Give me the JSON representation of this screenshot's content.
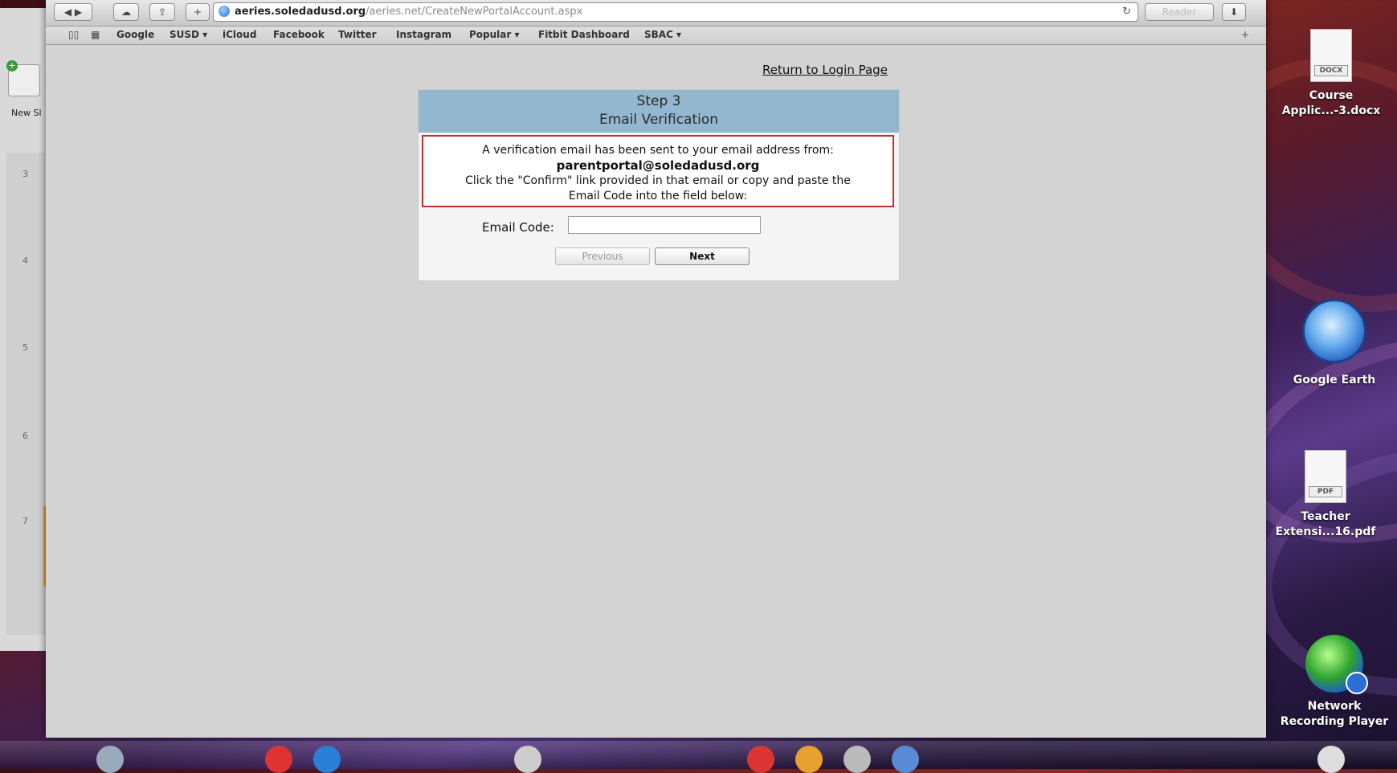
{
  "browser": {
    "url_host": "aeries.soledadusd.org",
    "url_path": "/aeries.net/CreateNewPortalAccount.aspx",
    "reader_label": "Reader",
    "bookmarks": [
      "Google",
      "SUSD ▾",
      "iCloud",
      "Facebook",
      "Twitter",
      "Instagram",
      "Popular ▾",
      "Fitbit Dashboard",
      "SBAC ▾"
    ]
  },
  "background_app": {
    "new_slide_label": "New Sl",
    "slide_numbers": [
      "3",
      "4",
      "5",
      "6",
      "7"
    ]
  },
  "page": {
    "return_link": "Return to Login Page",
    "step_title": "Step 3",
    "step_subtitle": "Email Verification",
    "notice_line1": "A verification email has been sent to your email address from:",
    "notice_email": "parentportal@soledadusd.org",
    "notice_line2": "Click the \"Confirm\" link provided in that email or copy and paste the",
    "notice_line3": "Email Code into the field below:",
    "email_code_label": "Email Code:",
    "email_code_value": "",
    "previous_label": "Previous",
    "next_label": "Next"
  },
  "desktop": {
    "icons": [
      {
        "line1": "Course",
        "line2": "Applic...-3.docx",
        "tag": "DOCX"
      },
      {
        "line1": "Google Earth",
        "line2": ""
      },
      {
        "line1": "Teacher",
        "line2": "Extensi...16.pdf",
        "tag": "PDF"
      },
      {
        "line1": "Network",
        "line2": "Recording Player"
      }
    ]
  }
}
